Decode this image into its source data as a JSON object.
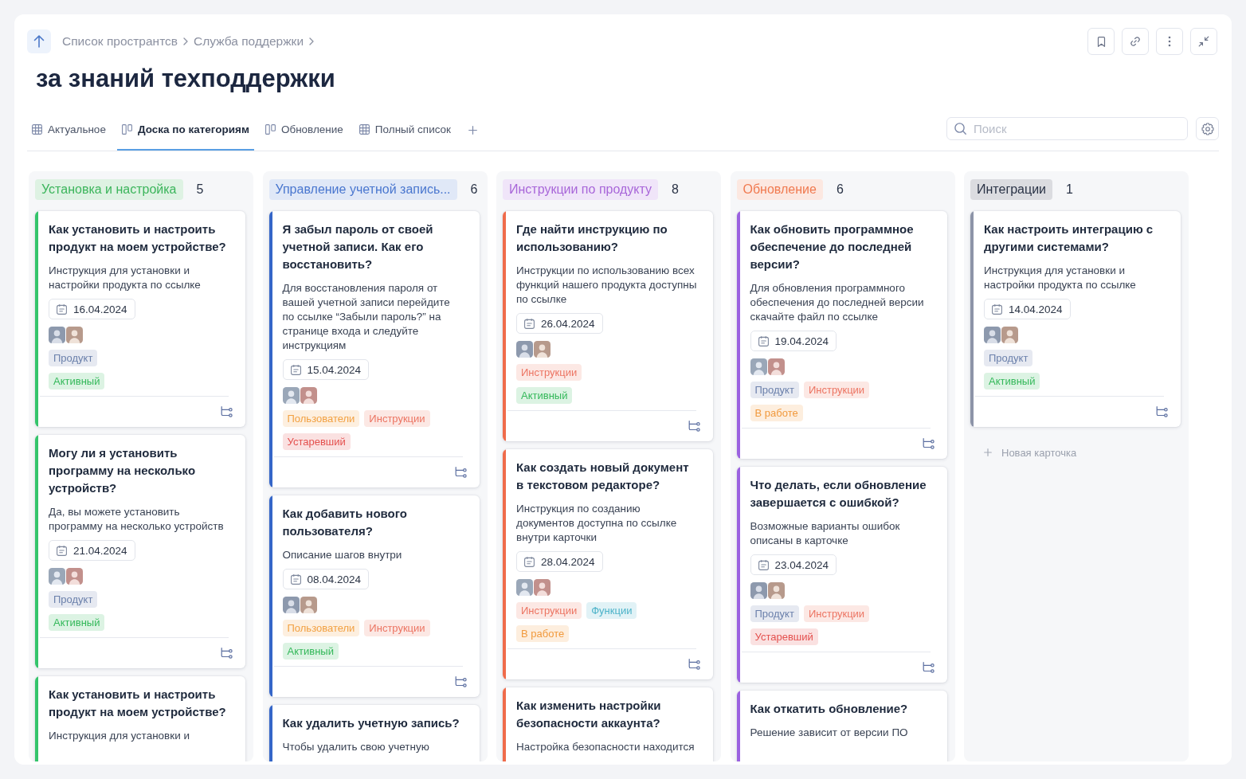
{
  "breadcrumbs": [
    "Список пространтсв",
    "Служба поддержки"
  ],
  "page_title": "за знаний техподдержки",
  "tabs": [
    {
      "label": "Актуальное",
      "kind": "table",
      "selected": false
    },
    {
      "label": "Доска по категориям",
      "kind": "board",
      "selected": true
    },
    {
      "label": "Обновление",
      "kind": "board",
      "selected": false
    },
    {
      "label": "Полный список",
      "kind": "table",
      "selected": false
    }
  ],
  "search": {
    "placeholder": "Поиск"
  },
  "columns": [
    {
      "title": "Установка и настройка",
      "color": "#3cb55c",
      "count": "5",
      "cards": [
        {
          "title": "Как установить и настроить продукт на моем устройстве?",
          "description": "Инструкция для установки и настройки продукта по ссылке",
          "date": "16.04.2024",
          "color": "#34c46b",
          "tags": [
            {
              "label": "Продукт",
              "color": "#6b80ab"
            }
          ],
          "status": {
            "label": "Активный",
            "color": "#34b85a"
          }
        },
        {
          "title": "Могу ли я установить программу на несколько устройств?",
          "description": "Да, вы можете установить программу на несколько устройств",
          "date": "21.04.2024",
          "color": "#34c46b",
          "tags": [
            {
              "label": "Продукт",
              "color": "#6b80ab"
            }
          ],
          "status": {
            "label": "Активный",
            "color": "#34b85a"
          }
        },
        {
          "title": "Как установить и настроить продукт на моем устройстве?",
          "description": "Инструкция для установки и",
          "color": "#34c46b"
        }
      ]
    },
    {
      "title": "Управление учетной запись...",
      "color": "#4a77cf",
      "count": "6",
      "cards": [
        {
          "title": "Я забыл пароль от своей учетной записи. Как его восстановить?",
          "description": "Для восстановления пароля от вашей учетной записи перейдите по ссылке “Забыли пароль?” на странице входа и следуйте инструкциям",
          "date": "15.04.2024",
          "color": "#3566c8",
          "tags": [
            {
              "label": "Пользователи",
              "color": "#f2a142"
            },
            {
              "label": "Инструкции",
              "color": "#ec7563"
            }
          ],
          "status": {
            "label": "Устаревший",
            "color": "#e4504e"
          }
        },
        {
          "title": "Как добавить нового пользователя?",
          "description": "Описание шагов внутри",
          "date": "08.04.2024",
          "color": "#3566c8",
          "tags": [
            {
              "label": "Пользователи",
              "color": "#f2a142"
            },
            {
              "label": "Инструкции",
              "color": "#ec7563"
            }
          ],
          "status": {
            "label": "Активный",
            "color": "#34b85a"
          }
        },
        {
          "title": "Как удалить учетную запись?",
          "description": "Чтобы удалить свою учетную",
          "color": "#3566c8"
        }
      ]
    },
    {
      "title": "Инструкции по продукту",
      "color": "#a866d9",
      "count": "8",
      "cards": [
        {
          "title": "Где найти инструкцию по использованию?",
          "description": "Инструкции по использованию всех функций нашего продукта доступны по ссылке",
          "date": "26.04.2024",
          "color": "#ef6b4b",
          "tags": [
            {
              "label": "Инструкции",
              "color": "#ec7563"
            }
          ],
          "status": {
            "label": "Активный",
            "color": "#34b85a"
          }
        },
        {
          "title": "Как создать новый документ в текстовом редакторе?",
          "description": "Инструкция по созданию документов доступна по ссылке внутри карточки",
          "date": "28.04.2024",
          "color": "#ef6b4b",
          "tags": [
            {
              "label": "Инструкции",
              "color": "#ec7563"
            },
            {
              "label": "Функции",
              "color": "#4db3c9"
            }
          ],
          "status": {
            "label": "В работе",
            "color": "#f19a3e"
          }
        },
        {
          "title": "Как изменить настройки безопасности аккаунта?",
          "description": "Настройка безопасности находится",
          "color": "#ef6b4b"
        }
      ]
    },
    {
      "title": "Обновление",
      "color": "#f07a50",
      "count": "6",
      "cards": [
        {
          "title": "Как обновить программное обеспечение до последней версии?",
          "description": "Для обновления программного обеспечения до последней версии скачайте файл по ссылке",
          "date": "19.04.2024",
          "color": "#9b62e0",
          "tags": [
            {
              "label": "Продукт",
              "color": "#6b80ab"
            },
            {
              "label": "Инструкции",
              "color": "#ec7563"
            }
          ],
          "status": {
            "label": "В работе",
            "color": "#f19a3e"
          }
        },
        {
          "title": "Что делать, если обновление завершается с ошибкой?",
          "description": "Возможные варианты ошибок описаны в карточке",
          "date": "23.04.2024",
          "color": "#9b62e0",
          "tags": [
            {
              "label": "Продукт",
              "color": "#6b80ab"
            },
            {
              "label": "Инструкции",
              "color": "#ec7563"
            }
          ],
          "status": {
            "label": "Устаревший",
            "color": "#e4504e"
          }
        },
        {
          "title": "Как откатить обновление?",
          "description": "Решение зависит от версии ПО",
          "color": "#9b62e0"
        }
      ]
    },
    {
      "title": "Интеграции",
      "color": "#2a3346",
      "count": "1",
      "cards": [
        {
          "title": "Как настроить интеграцию с другими системами?",
          "description": "Инструкция для установки и настройки продукта по ссылке",
          "date": "14.04.2024",
          "color": "#8d94a8",
          "tags": [
            {
              "label": "Продукт",
              "color": "#6b80ab"
            }
          ],
          "status": {
            "label": "Активный",
            "color": "#34b85a"
          }
        }
      ],
      "add_card": "Новая карточка"
    }
  ]
}
